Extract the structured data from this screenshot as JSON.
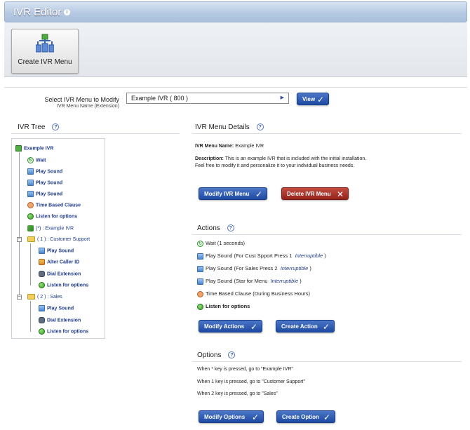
{
  "window": {
    "title": "IVR Editor"
  },
  "toolbar": {
    "create_label": "Create IVR Menu"
  },
  "selector": {
    "label": "Select IVR Menu to Modify",
    "sublabel": "IVR Menu Name (Extension)",
    "value": "Example IVR ( 800 )",
    "view_label": "View"
  },
  "tree": {
    "title": "IVR Tree",
    "root": "Example IVR",
    "items": [
      {
        "label": "Wait",
        "icon": "wait-icon"
      },
      {
        "label": "Play Sound",
        "icon": "speaker-icon"
      },
      {
        "label": "Play Sound",
        "icon": "speaker-icon"
      },
      {
        "label": "Play Sound",
        "icon": "speaker-icon"
      },
      {
        "label": "Time Based Clause",
        "icon": "clock-icon"
      },
      {
        "label": "Listen for options",
        "icon": "listen-icon"
      },
      {
        "label": "(*) : Example IVR",
        "icon": "goto-icon"
      },
      {
        "label": "( 1 ) : Customer Support",
        "icon": "folder-icon"
      },
      {
        "label": "Play Sound",
        "icon": "speaker-icon"
      },
      {
        "label": "Alter Caller ID",
        "icon": "person-icon"
      },
      {
        "label": "Dial Extension",
        "icon": "phone-icon"
      },
      {
        "label": "Listen for options",
        "icon": "listen-icon"
      },
      {
        "label": "( 2 ) : Sales",
        "icon": "folder-icon"
      },
      {
        "label": "Play Sound",
        "icon": "speaker-icon"
      },
      {
        "label": "Dial Extension",
        "icon": "phone-icon"
      },
      {
        "label": "Listen for options",
        "icon": "listen-icon"
      }
    ]
  },
  "details": {
    "title": "IVR Menu Details",
    "name_label": "IVR Menu Name:",
    "name_value": "Example IVR",
    "desc_label": "Description:",
    "desc_value": "This is an example IVR that is included with the initial installation. Feel free to modify it and personalize it to your individual business needs.",
    "modify_label": "Modify IVR Menu",
    "delete_label": "Delete IVR Menu"
  },
  "actions": {
    "title": "Actions",
    "items": [
      {
        "text": "Wait (1 seconds)",
        "em": ""
      },
      {
        "text": "Play Sound (For Cust Spport Press 1",
        "em": "Interruptible",
        "tail": " )"
      },
      {
        "text": "Play Sound (For Sales Press 2",
        "em": "Interruptible",
        "tail": " )"
      },
      {
        "text": "Play Sound (Star for Menu",
        "em": "Interruptible",
        "tail": " )"
      },
      {
        "text": "Time Based Clause (During Business Hours)",
        "em": ""
      },
      {
        "text": "Listen for options",
        "em": ""
      }
    ],
    "modify_label": "Modify Actions",
    "create_label": "Create Action"
  },
  "options": {
    "title": "Options",
    "items": [
      "When * key is pressed, go to \"Example IVR\"",
      "When 1 key is pressed, go to \"Customer Support\"",
      "When 2 key is pressed, go to \"Sales\""
    ],
    "modify_label": "Modify Options",
    "create_label": "Create Option"
  },
  "colors": {
    "primary_button": "#2a55ad",
    "danger_button": "#a52c22",
    "title_bar": "#b4c8e1"
  }
}
